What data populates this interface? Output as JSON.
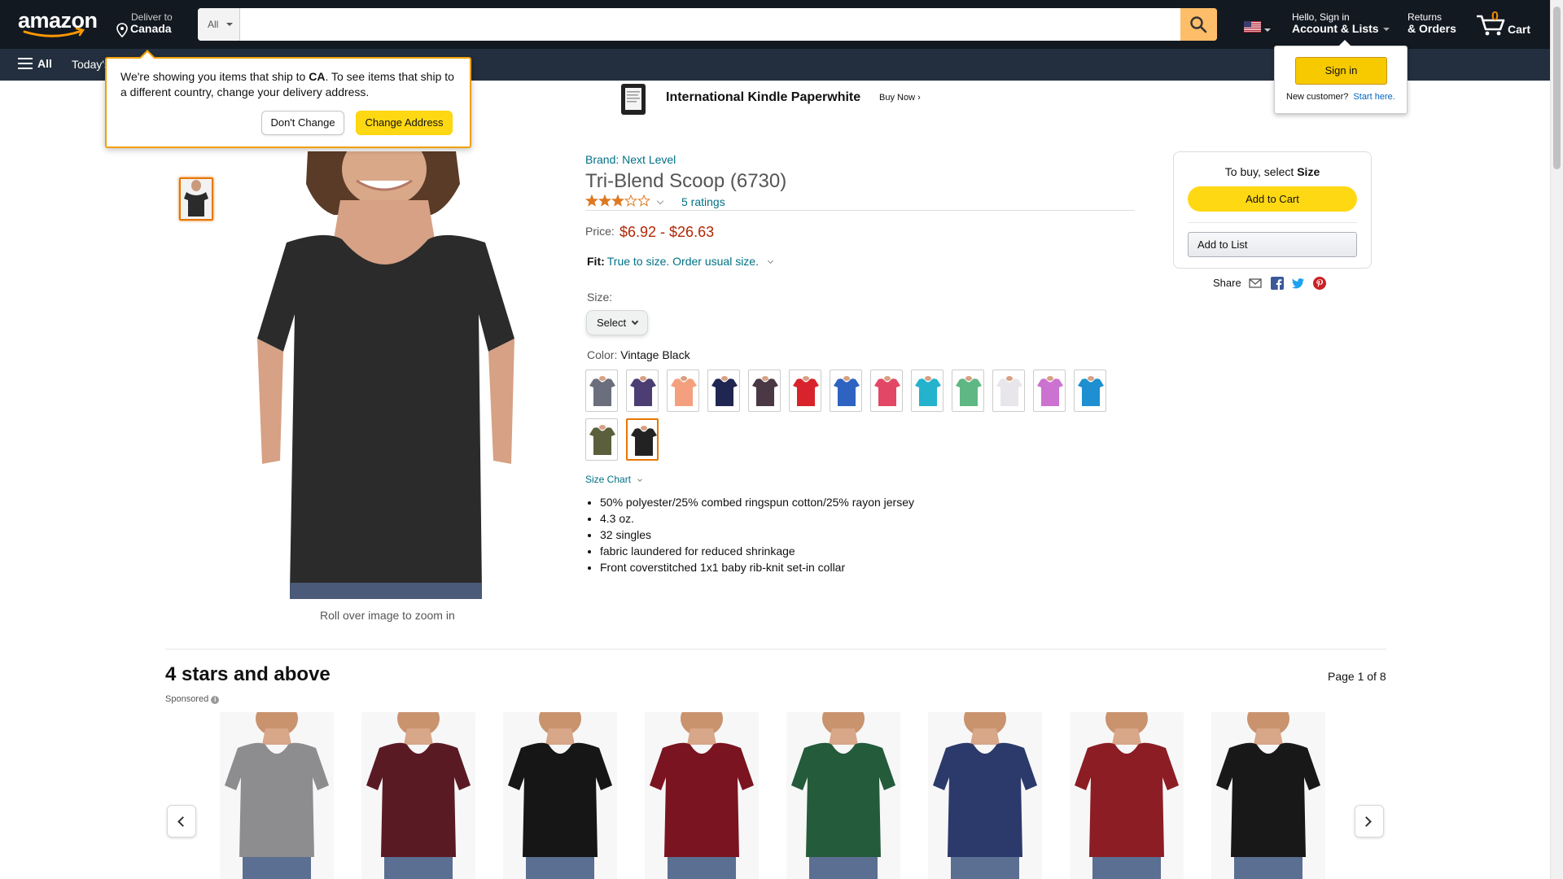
{
  "header": {
    "logo_text": "amazon",
    "deliver_line1": "Deliver to",
    "deliver_line2": "Canada",
    "search_category": "All",
    "search_placeholder": "",
    "account_line1": "Hello, Sign in",
    "account_line2": "Account & Lists",
    "returns_line1": "Returns",
    "returns_line2": "& Orders",
    "cart_count": "0",
    "cart_label": "Cart",
    "colors": {
      "nav_bg": "#131921",
      "subnav_bg": "#232f3e",
      "search_button": "#febd69",
      "cart_count": "#f08804"
    }
  },
  "subnav": {
    "all_label": "All",
    "today_label": "Today's"
  },
  "delivery_popover": {
    "message_pre": "We're showing you items that ship to ",
    "message_country": "CA",
    "message_post": ". To see items that ship to a different country, change your delivery address.",
    "dont_change_label": "Don't Change",
    "change_address_label": "Change Address"
  },
  "signin_flyout": {
    "sign_in_label": "Sign in",
    "new_customer": "New customer?",
    "start_here": "Start here."
  },
  "banner": {
    "title": "International Kindle Paperwhite",
    "cta": "Buy Now ›"
  },
  "product": {
    "brand": "Brand: Next Level",
    "title": "Tri-Blend Scoop (6730)",
    "rating_value": 3,
    "ratings_count": "5 ratings",
    "price_label": "Price:",
    "price_range": "$6.92 - $26.63",
    "fit_label": "Fit:",
    "fit_value": "True to size. Order usual size.",
    "size_label": "Size:",
    "size_selected": "Select",
    "color_label": "Color: ",
    "color_selected": "Vintage Black",
    "swatch_colors": [
      "#6b6e7d",
      "#4c3e72",
      "#f4a07e",
      "#1f2652",
      "#4a3845",
      "#d8232c",
      "#2f63c1",
      "#e24765",
      "#24b2cc",
      "#5fb884",
      "#e8e6ea",
      "#cc72d0",
      "#1e8fd0",
      "#5b5f3c",
      "#222222"
    ],
    "size_chart_label": "Size Chart",
    "bullets": [
      "50% polyester/25% combed ringspun cotton/25% rayon jersey",
      "4.3 oz.",
      "32 singles",
      "fabric laundered for reduced shrinkage",
      "Front coverstitched 1x1 baby rib-knit set-in collar"
    ],
    "zoom_hint": "Roll over image to zoom in",
    "main_image_color": "#2b2b2b"
  },
  "buybox": {
    "to_buy_pre": "To buy, select ",
    "to_buy_bold": "Size",
    "add_to_cart": "Add to Cart",
    "add_to_list": "Add to List",
    "share_label": "Share"
  },
  "carousel": {
    "title": "4 stars and above",
    "page_info": "Page 1 of 8",
    "sponsored": "Sponsored",
    "items": [
      {
        "shirt_color": "#8d8d8f"
      },
      {
        "shirt_color": "#5a1a24"
      },
      {
        "shirt_color": "#161616"
      },
      {
        "shirt_color": "#7a1420"
      },
      {
        "shirt_color": "#245b3b"
      },
      {
        "shirt_color": "#2c3a6b"
      },
      {
        "shirt_color": "#8c1d25"
      },
      {
        "shirt_color": "#181818"
      }
    ]
  }
}
